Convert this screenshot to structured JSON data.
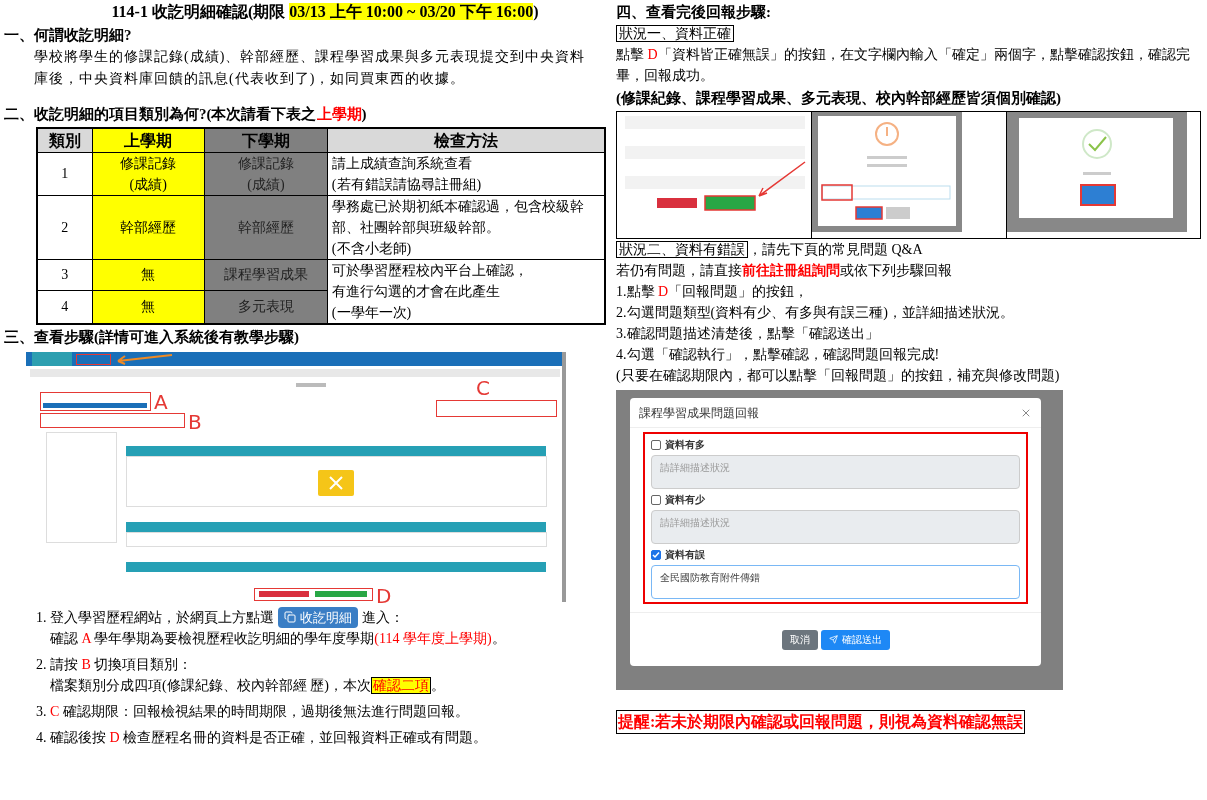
{
  "left": [
    {
      "kind": "title",
      "runs": [
        {
          "kind": "plain",
          "text": "114-1 收訖明細確認(期限 "
        },
        {
          "kind": "marker",
          "text": "03/13 上午 10:00 ~ 03/20 下午 16:00"
        },
        {
          "kind": "plain",
          "text": ")"
        }
      ]
    },
    {
      "kind": "heading",
      "runs": [
        {
          "kind": "plain",
          "text": "一、何謂收訖明細?"
        }
      ]
    },
    {
      "kind": "indented_paragraph",
      "runs": [
        {
          "kind": "plain",
          "text": "學校將學生的修課記錄(成績)、幹部經歷、課程學習成果與多元表現提交到中央資料庫後，中央資料庫回饋的訊息(代表收到了)，如同買東西的收據。"
        }
      ]
    },
    {
      "kind": "heading",
      "runs": [
        {
          "kind": "plain",
          "text": "二、收訖明細的項目類別為何?(本次請看下表之"
        },
        {
          "kind": "red",
          "text": "上學期"
        },
        {
          "kind": "plain",
          "text": ")"
        }
      ]
    },
    {
      "kind": "table",
      "columns": [
        {
          "label": "類別",
          "kind": "plain"
        },
        {
          "label": "上學期",
          "kind": "current"
        },
        {
          "label": "下學期",
          "kind": "other"
        },
        {
          "label": "檢查方法",
          "kind": "plain"
        }
      ],
      "rows": [
        {
          "category": "1",
          "current": [
            "修課記錄",
            "(成績)"
          ],
          "other": [
            "修課記錄",
            "(成績)"
          ],
          "method": [
            "請上成績查詢系統查看",
            "(若有錯誤請協尋註冊組)"
          ]
        },
        {
          "category": "2",
          "current": [
            "幹部經歷"
          ],
          "other": [
            "幹部經歷"
          ],
          "method": [
            "學務處已於期初紙本確認過，包含校級幹部、社團幹部與班級幹部。",
            "(不含小老師)"
          ]
        },
        {
          "category": "3",
          "current": [
            "無"
          ],
          "other": [
            "課程學習成果"
          ]
        },
        {
          "category": "4",
          "current": [
            "無"
          ],
          "other": [
            "多元表現"
          ]
        }
      ],
      "merged_method": [
        "可於學習歷程校內平台上確認，",
        "有進行勾選的才會在此產生",
        "(一學年一次)"
      ]
    },
    {
      "kind": "heading",
      "runs": [
        {
          "kind": "plain",
          "text": "三、查看步驟(詳情可進入系統後有教學步驟)"
        }
      ]
    },
    {
      "kind": "webpage_screenshot",
      "callouts": [
        "A",
        "B",
        "C",
        "D"
      ]
    },
    {
      "kind": "step",
      "number": "1.",
      "lines": [
        [
          {
            "kind": "plain",
            "text": "登入學習歷程網站，於網頁上方點選"
          },
          {
            "kind": "chip",
            "text": "收訖明細"
          },
          {
            "kind": "plain",
            "text": "進入："
          }
        ],
        [
          {
            "kind": "plain",
            "text": "確認 "
          },
          {
            "kind": "red",
            "text": "A"
          },
          {
            "kind": "plain",
            "text": " 學年學期為要檢視歷程收訖明細的學年度學期"
          },
          {
            "kind": "red",
            "text": "(114 學年度上學期)"
          },
          {
            "kind": "plain",
            "text": "。"
          }
        ]
      ]
    },
    {
      "kind": "step",
      "number": "2.",
      "lines": [
        [
          {
            "kind": "plain",
            "text": "請按 "
          },
          {
            "kind": "red",
            "text": "B"
          },
          {
            "kind": "plain",
            "text": " 切換項目類別："
          }
        ],
        [
          {
            "kind": "plain",
            "text": "檔案類別分成四項(修課紀錄、校內幹部經 歷)，本次"
          },
          {
            "kind": "boxed_marker",
            "text": "確認二項"
          },
          {
            "kind": "plain",
            "text": "。"
          }
        ]
      ]
    },
    {
      "kind": "step",
      "number": "3.",
      "lines": [
        [
          {
            "kind": "red",
            "text": "C"
          },
          {
            "kind": "plain",
            "text": " 確認期限：回報檢視結果的時間期限，過期後無法進行問題回報。"
          }
        ]
      ]
    },
    {
      "kind": "step",
      "number": "4.",
      "lines": [
        [
          {
            "kind": "plain",
            "text": "確認後按 "
          },
          {
            "kind": "red",
            "text": "D"
          },
          {
            "kind": "plain",
            "text": " 檢查歷程名冊的資料是否正確，並回報資料正確或有問題。"
          }
        ]
      ]
    }
  ],
  "right": [
    {
      "kind": "heading",
      "runs": [
        {
          "kind": "plain",
          "text": "四、查看完後回報步驟:"
        }
      ]
    },
    {
      "kind": "paragraph",
      "runs": [
        {
          "kind": "boxed",
          "text": "狀況一、資料正確"
        }
      ]
    },
    {
      "kind": "paragraph",
      "runs": [
        {
          "kind": "plain",
          "text": "點擊 "
        },
        {
          "kind": "red",
          "text": "D"
        },
        {
          "kind": "plain",
          "text": "「資料皆正確無誤」的按鈕，在文字欄內輸入「確定」兩個字，點擊確認按鈕，確認完畢，回報成功。"
        }
      ]
    },
    {
      "kind": "heading",
      "runs": [
        {
          "kind": "plain",
          "text": "(修課紀錄、課程學習成果、多元表現、校內幹部經歷皆須個別確認)"
        }
      ]
    },
    {
      "kind": "screenshot_row"
    },
    {
      "kind": "paragraph",
      "runs": [
        {
          "kind": "boxed",
          "text": "狀況二、資料有錯誤"
        },
        {
          "kind": "plain",
          "text": "，請先下頁的常見問題 Q&A"
        }
      ]
    },
    {
      "kind": "paragraph",
      "runs": [
        {
          "kind": "plain",
          "text": "若仍有問題，請直接"
        },
        {
          "kind": "red_bold",
          "text": "前往註冊組詢問"
        },
        {
          "kind": "plain",
          "text": "或依下列步驟回報"
        }
      ]
    },
    {
      "kind": "paragraph",
      "runs": [
        {
          "kind": "plain",
          "text": "1.點擊 "
        },
        {
          "kind": "red",
          "text": "D"
        },
        {
          "kind": "plain",
          "text": "「回報問題」的按鈕，"
        }
      ]
    },
    {
      "kind": "paragraph",
      "runs": [
        {
          "kind": "plain",
          "text": "2.勾選問題類型(資料有少、有多與有誤三種)，並詳細描述狀況。"
        }
      ]
    },
    {
      "kind": "paragraph",
      "runs": [
        {
          "kind": "plain",
          "text": "3.確認問題描述清楚後，點擊「確認送出」"
        }
      ]
    },
    {
      "kind": "paragraph",
      "runs": [
        {
          "kind": "plain",
          "text": "4.勾選「確認執行」，點擊確認，確認問題回報完成!"
        }
      ]
    },
    {
      "kind": "paragraph",
      "runs": [
        {
          "kind": "plain",
          "text": "(只要在確認期限內，都可以點擊「回報問題」的按鈕，補充與修改問題)"
        }
      ]
    },
    {
      "kind": "dialog_screenshot",
      "title": "課程學習成果問題回報",
      "options": [
        {
          "label": "資料有多",
          "checked": false,
          "placeholder": "請詳細描述狀況"
        },
        {
          "label": "資料有少",
          "checked": false,
          "placeholder": "請詳細描述狀況"
        },
        {
          "label": "資料有誤",
          "checked": true,
          "value": "全民國防教育附件傳錯"
        }
      ],
      "buttons": [
        {
          "label": "取消",
          "kind": "secondary"
        },
        {
          "label": "確認送出",
          "kind": "primary"
        }
      ]
    },
    {
      "kind": "reminder",
      "text": "提醒:若未於期限內確認或回報問題，則視為資料確認無誤"
    }
  ]
}
